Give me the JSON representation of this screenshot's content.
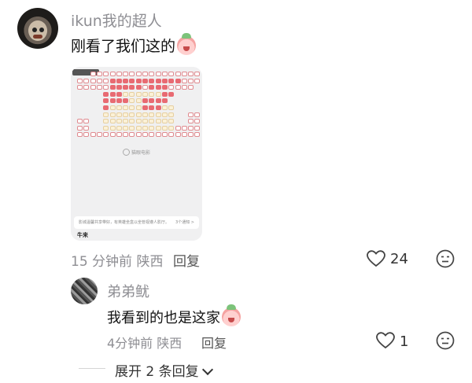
{
  "comment": {
    "username": "ikun我的超人",
    "text": "刚看了我们这的",
    "emoji": "crying-face-emoji",
    "image": {
      "notice_text": "影城温馨共享带好，有英雄坐盒以坐管视遵人影厅。",
      "notice_more": "3个通知 >",
      "cinema_name": "牛来",
      "logo_text": "猫眼电影"
    },
    "meta": "15 分钟前 陕西",
    "reply_label": "回复",
    "likes": "24"
  },
  "reply": {
    "username": "弟弟鱿",
    "text": "我看到的也是这家",
    "emoji": "crying-face-emoji",
    "meta": "4分钟前 陕西",
    "reply_label": "回复",
    "likes": "1"
  },
  "expand_label": "展开 2 条回复",
  "colors": {
    "sold_seat": "#e86a72",
    "best_area": "#fbf1d7",
    "muted_text": "#8e8e93"
  }
}
